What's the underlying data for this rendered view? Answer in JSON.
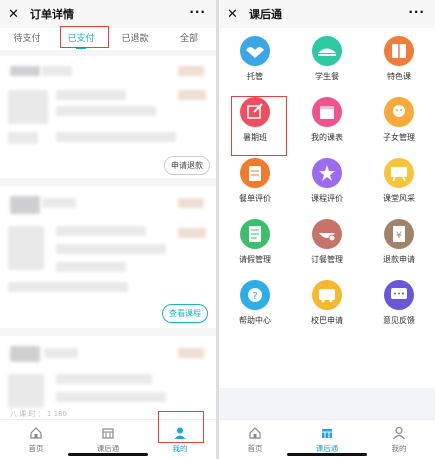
{
  "left": {
    "title": "订单详情",
    "tabs": [
      "待支付",
      "已支付",
      "已退款",
      "全部"
    ],
    "active_tab": 1,
    "cards": {
      "refund_button": "申请退款",
      "view_course_button": "查看课程",
      "bottom_partial_text": "八 课 时 ：  1   180"
    },
    "nav": [
      {
        "label": "首页",
        "icon": "home-icon"
      },
      {
        "label": "课后通",
        "icon": "building-icon"
      },
      {
        "label": "我的",
        "icon": "user-icon"
      }
    ],
    "active_nav": 2
  },
  "right": {
    "title": "课后通",
    "services": [
      {
        "label": "托管",
        "icon": "hands-heart-icon",
        "color": "#3aa7e6"
      },
      {
        "label": "学生餐",
        "icon": "meal-icon",
        "color": "#2cc9a3"
      },
      {
        "label": "特色课",
        "icon": "book-icon",
        "color": "#f07b3a"
      },
      {
        "label": "暑期班",
        "icon": "edit-icon",
        "color": "#f24d5f"
      },
      {
        "label": "我的课表",
        "icon": "calendar-icon",
        "color": "#f0528f"
      },
      {
        "label": "子女管理",
        "icon": "family-icon",
        "color": "#f7a93a"
      },
      {
        "label": "餐单评价",
        "icon": "clipboard-icon",
        "color": "#f27a2a"
      },
      {
        "label": "课程评价",
        "icon": "star-icon",
        "color": "#9b6bf0"
      },
      {
        "label": "课堂风采",
        "icon": "board-icon",
        "color": "#f6c53b"
      },
      {
        "label": "请假管理",
        "icon": "document-icon",
        "color": "#3bbf6b"
      },
      {
        "label": "订餐管理",
        "icon": "bowl-icon",
        "color": "#c8736a"
      },
      {
        "label": "退款申请",
        "icon": "refund-icon",
        "color": "#a0846a"
      },
      {
        "label": "帮助中心",
        "icon": "question-icon",
        "color": "#2eaee8"
      },
      {
        "label": "校巴申请",
        "icon": "bus-icon",
        "color": "#f5b82e"
      },
      {
        "label": "意见反馈",
        "icon": "chat-icon",
        "color": "#6a56d8"
      }
    ],
    "nav": [
      {
        "label": "首页",
        "icon": "home-icon"
      },
      {
        "label": "课后通",
        "icon": "building-icon"
      },
      {
        "label": "我的",
        "icon": "user-icon"
      }
    ],
    "active_nav": 1
  },
  "colors": {
    "accent": "#18b3c9",
    "nav_active": "#1aa5e6",
    "highlight": "#e74040"
  }
}
